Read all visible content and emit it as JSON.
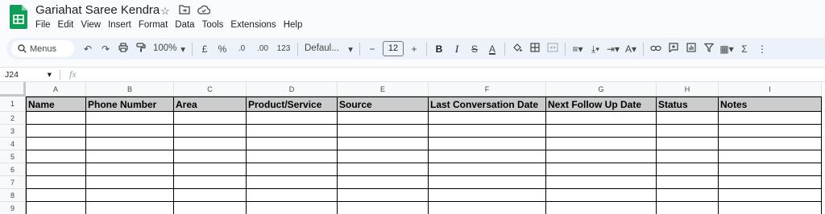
{
  "doc": {
    "title": "Gariahat Saree Kendra",
    "title_icons": [
      "star-icon",
      "move-to-folder-icon",
      "cloud-saved-icon"
    ]
  },
  "menu": [
    "File",
    "Edit",
    "View",
    "Insert",
    "Format",
    "Data",
    "Tools",
    "Extensions",
    "Help"
  ],
  "toolbar": {
    "search_label": "Menus",
    "zoom": "100%",
    "currency": "£",
    "percent": "%",
    "decrease_decimal": ".0",
    "increase_decimal": ".00",
    "number_format": "123",
    "font": "Defaul...",
    "font_size": "12",
    "minus": "−",
    "plus": "+",
    "bold": "B",
    "italic": "I",
    "strike": "S",
    "text_color": "A",
    "sigma": "Σ"
  },
  "formula_bar": {
    "cell_ref": "J24",
    "fx": "fx",
    "value": ""
  },
  "sheet": {
    "columns": [
      "A",
      "B",
      "C",
      "D",
      "E",
      "F",
      "G",
      "H",
      "I"
    ],
    "headers": [
      "Name",
      "Phone Number",
      "Area",
      "Product/Service",
      "Source",
      "Last Conversation Date",
      "Next Follow Up Date",
      "Status",
      "Notes"
    ],
    "row_numbers": [
      "1",
      "2",
      "3",
      "4",
      "5",
      "6",
      "7",
      "8",
      "9"
    ],
    "header_fill": "#cccccc"
  },
  "colors": {
    "logo_green": "#0f9d58",
    "toolbar_bg": "#edf2fa",
    "page_bg": "#f9fbfd"
  }
}
